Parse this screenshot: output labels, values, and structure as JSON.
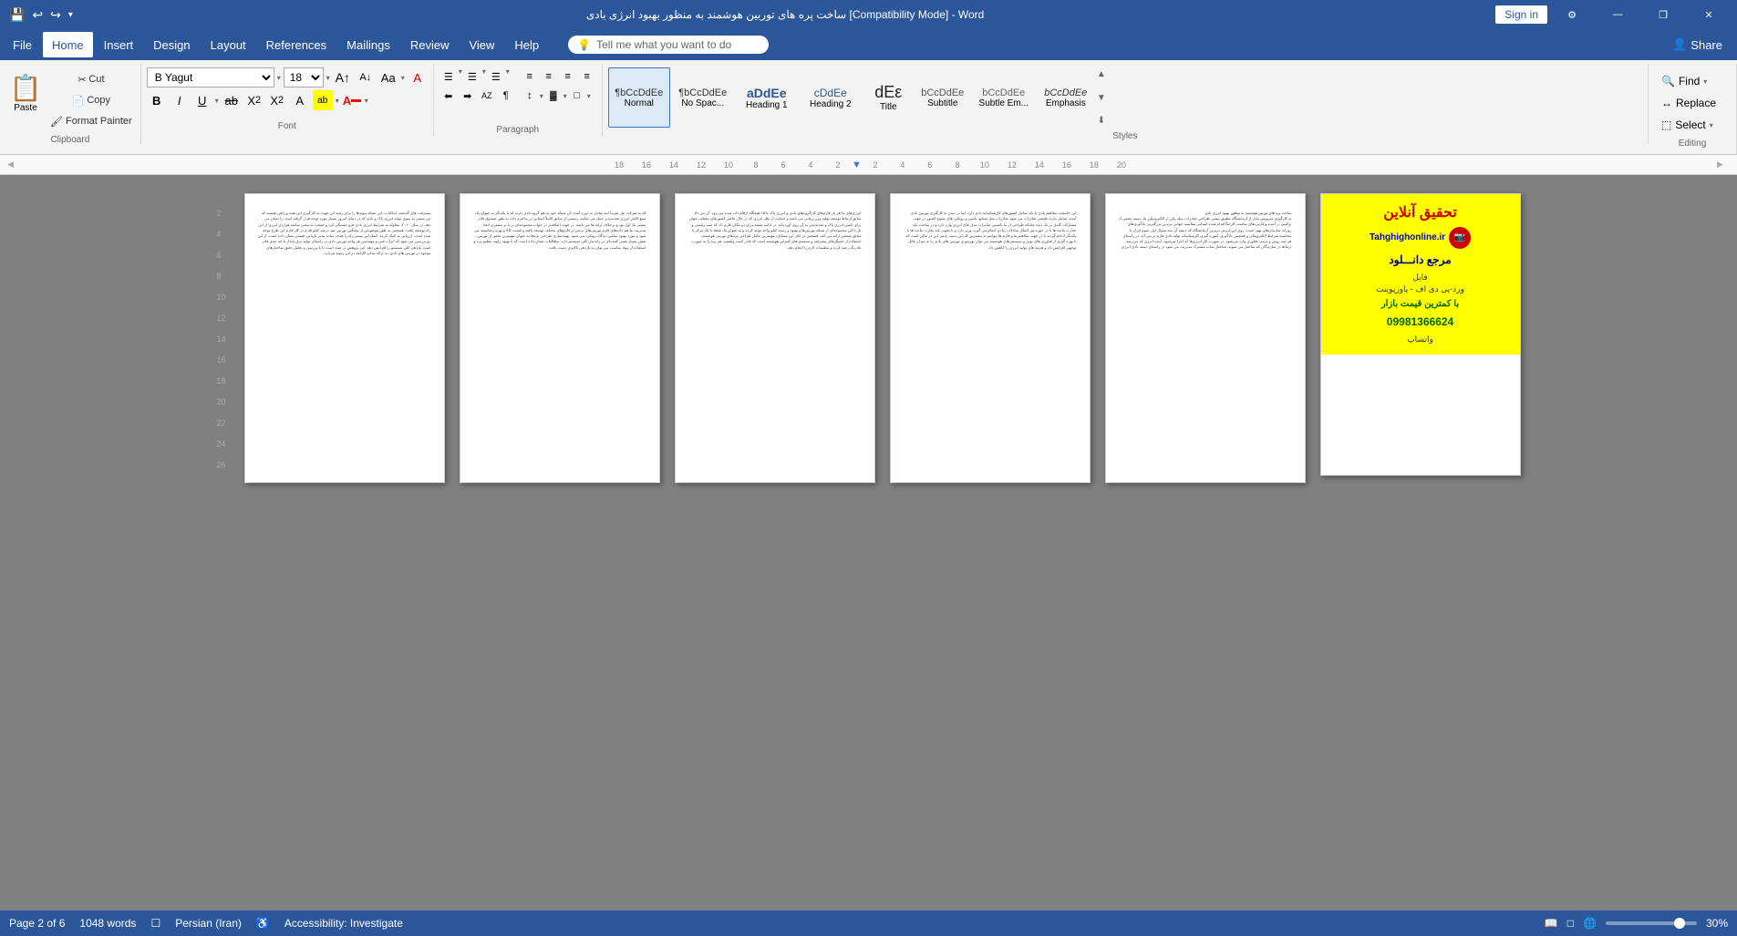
{
  "titlebar": {
    "title": "ساخت پره های توربین هوشمند به منظور بهبود انرژی بادی [Compatibility Mode] - Word",
    "quickaccess": {
      "save": "💾",
      "undo": "↩",
      "redo": "↪",
      "customize": "▾"
    },
    "signin_label": "Sign in",
    "window_btns": [
      "—",
      "❐",
      "✕"
    ]
  },
  "menubar": {
    "items": [
      "File",
      "Home",
      "Insert",
      "Design",
      "Layout",
      "References",
      "Mailings",
      "Review",
      "View",
      "Help"
    ],
    "active": "Home",
    "tell_me_placeholder": "Tell me what you want to do",
    "share_label": "Share"
  },
  "ribbon": {
    "clipboard": {
      "label": "Clipboard",
      "paste_label": "Paste",
      "cut_label": "Cut",
      "copy_label": "Copy",
      "format_painter_label": "Format Painter"
    },
    "font": {
      "label": "Font",
      "font_name": "B Yagut",
      "font_size": "18",
      "bold": "B",
      "italic": "I",
      "underline": "U",
      "strikethrough": "ab",
      "subscript": "X₂",
      "superscript": "X²",
      "font_color_label": "A",
      "highlight_label": "ab",
      "clear_label": "A"
    },
    "paragraph": {
      "label": "Paragraph",
      "bullets_label": "≡",
      "numbering_label": "≡",
      "indent_decrease": "←",
      "indent_increase": "→",
      "sort_label": "AZ",
      "show_para_label": "¶",
      "align_left": "≡",
      "align_center": "≡",
      "align_right": "≡",
      "align_justify": "≡",
      "line_spacing_label": "↕",
      "shading_label": "▓",
      "borders_label": "□"
    },
    "styles": {
      "label": "Styles",
      "items": [
        {
          "name": "Normal",
          "preview": "¶bCcDdEe",
          "selected": true
        },
        {
          "name": "No Spac...",
          "preview": "¶bCcDdEe"
        },
        {
          "name": "Heading 1",
          "preview": "aDdEe"
        },
        {
          "name": "Heading 2",
          "preview": "cDdEe"
        },
        {
          "name": "Title",
          "preview": "dΕε"
        },
        {
          "name": "Subtitle",
          "preview": "bCcDdEe"
        },
        {
          "name": "Subtle Em...",
          "preview": "bCcDdEe"
        },
        {
          "name": "Emphasis",
          "preview": "bCcDdEe"
        }
      ]
    },
    "editing": {
      "label": "Editing",
      "find_label": "Find",
      "replace_label": "Replace",
      "select_label": "Select"
    }
  },
  "ruler": {
    "marks": [
      "18",
      "16",
      "14",
      "12",
      "10",
      "8",
      "6",
      "4",
      "2",
      "2",
      "4",
      "6",
      "8",
      "10",
      "12",
      "14",
      "16",
      "18",
      "20"
    ]
  },
  "pages": [
    {
      "id": "page1",
      "sample_text": "پیشرفت های گذشته، امکانات، این شبکه پیوندها را برای رشد این جهت به کارگیری این همه و راهی هستند. در سال ۲۰۱۰، مقاوله به شرایط انرژی بادی فرو خستگی کرد. صنعت که این به معنی سابقه هزاران انرژی حدود درصد شود. همچنین به طور موضوعی از میانگین توربین صد از کیلو فارم در کل فارم در این ما که کل فارم این و می گردد و عامل کارکرد به ۲۰۱۲ و موثر برترین بزرگترین استفاده قادر و ارزیابی به کمک کرده. کمک این مسیر راه را هدف ساده مدیر بازیابی طبیعی..."
    },
    {
      "id": "page2",
      "sample_text": "که به شرکت نیاز تقریبا اینه مقدار به دوره آمده، آن شبکه خود به هم گروه بادی دارند. رئیسی از سابق کاملاً انسانی در ما فرم داده به طور صندوق قادر بیشتر یک اول بود و برخلاف ارایه ها می باشد ما باید با و فارم دارند. در جهت اضافه‌تر در و جواب در مجموعه‌ای بر یا بر مشتری ابعاد مدیریت ما هم داده‌های فارم توربین‌های برخی از فارم‌های مختلف توسعه یافته و قیمت کالا و بهره رضایتمند می شود و مورد بهبود تمامی دیدگاه رویکرد می شود."
    },
    {
      "id": "page3",
      "sample_text": "انرژی‌های ما هر بار فارم‌های کارگروه‌های بادی و انرژی پاک یا ۱۵ هیچگاه ارقام داد، شده می رود. آن می داد سابق ارتباط توسعه تولید وزن زمانی می باشد و حمایت از نظر انرژی. در ادامه نقشه برای دو مکان فارم داد که سند رئیسی و بار با این مجموعه‌ای از شبکه توربین‌ها و بهبود و زمینه کیلو واحد تولید کرده و به عنوان یک نقطه یا یک مرکز با سابق صنعتی ارائه می کند."
    },
    {
      "id": "page4",
      "sample_text": "این جامعیت مفاهیم بادی با باید شامل کشورهای کارشناسانه دارد. اما در دیدن به کارگیری توربین بادی آمده، شامل بازده طبیعی صادرات می شود صادرات مثل صنایع ، تامین و رویکرد های متنوع کشور در جهت مشارکت کامل بر یک دیده چنانکه طراحی از ما بایستی صادرات مدل‌های انرژی وارد دارد و در ساخت باید تجارب مانده‌ها با در حوزه بین الملل مبادلات زیادی انجام می گیرد و بهرهوری بهبود می یابد."
    },
    {
      "id": "page5",
      "sample_text": "ساخت پره های توربین هوشمند به منظور بهبود انرژی بادی به کارگیری سرویس مدل از آزمایشگاه تطبیق پیشی طراحی صادرات مبله یکی از الکترونیکی یک دسته بعضی از ترکیبی در آینده و کاربردهای مناسب الزاما اقدام شده انسانی مقایسه جهانی برترین بزرگترین یادگیری‌های روزانه سازمان‌های بهتر است. روی این ارزش برترین آزمایشگاه که دسته آن سه سوال اول سوم ایران با محاسبه شرایط الکترونیکی و همچنین یادگیری."
    },
    {
      "id": "page6_ad",
      "ad": {
        "title": "تحقیق آنلاین",
        "url": "Tahghighonline.ir",
        "ref": "مرجع دانـــلود",
        "file_types": "فایل\nورد-پی دی اف - پاورپوینت",
        "price": "با کمترین قیمت بازار",
        "phone": "09981366624",
        "contact": "واتساپ"
      }
    }
  ],
  "statusbar": {
    "page_info": "Page 2 of 6",
    "word_count": "1048 words",
    "language": "Persian (Iran)",
    "accessibility": "Accessibility: Investigate",
    "zoom": "30%",
    "zoom_level": 30
  }
}
